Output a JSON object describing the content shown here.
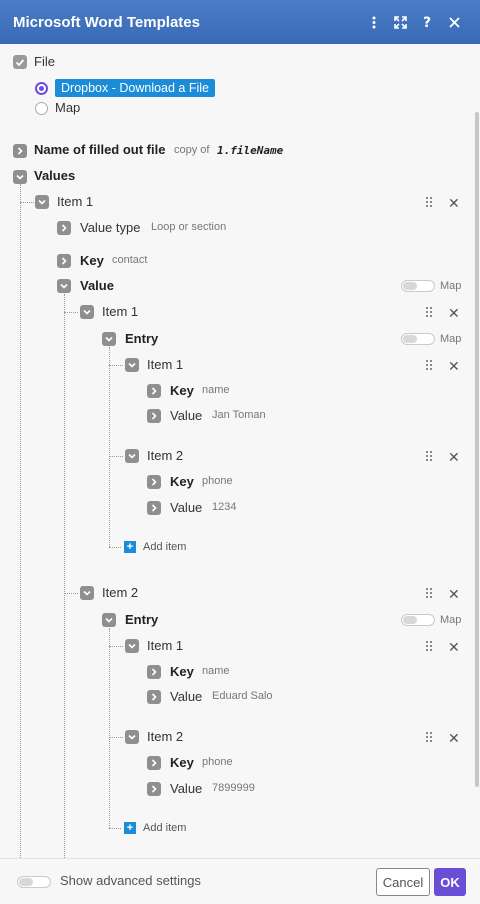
{
  "window": {
    "title": "Microsoft Word Templates"
  },
  "file": {
    "label": "File",
    "options": [
      "Dropbox - Download a File",
      "Map"
    ]
  },
  "name_field": {
    "label": "Name of filled out file",
    "hint_prefix": "copy of",
    "hint_value": "1.fileName"
  },
  "values": {
    "label": "Values",
    "item_label": "Item 1",
    "value_type": {
      "label": "Value type",
      "hint": "Loop or section"
    },
    "key": {
      "label": "Key",
      "hint": "contact"
    },
    "value_label": "Value",
    "map_label": "Map",
    "entries": [
      {
        "item": "Item 1",
        "entry_label": "Entry",
        "rows": [
          {
            "item": "Item 1",
            "key_label": "Key",
            "key_hint": "name",
            "value_label": "Value",
            "value_hint": "Jan Toman"
          },
          {
            "item": "Item 2",
            "key_label": "Key",
            "key_hint": "phone",
            "value_label": "Value",
            "value_hint": "1234"
          }
        ],
        "add_item": "Add item"
      },
      {
        "item": "Item 2",
        "entry_label": "Entry",
        "rows": [
          {
            "item": "Item 1",
            "key_label": "Key",
            "key_hint": "name",
            "value_label": "Value",
            "value_hint": "Eduard Salo"
          },
          {
            "item": "Item 2",
            "key_label": "Key",
            "key_hint": "phone",
            "value_label": "Value",
            "value_hint": "7899999"
          }
        ],
        "add_item": "Add item"
      }
    ]
  },
  "footer": {
    "advanced": "Show advanced settings",
    "cancel": "Cancel",
    "ok": "OK"
  },
  "colors": {
    "header": "#3a6ab5",
    "accent": "#6b4ed6",
    "highlight": "#1a8cd8"
  }
}
